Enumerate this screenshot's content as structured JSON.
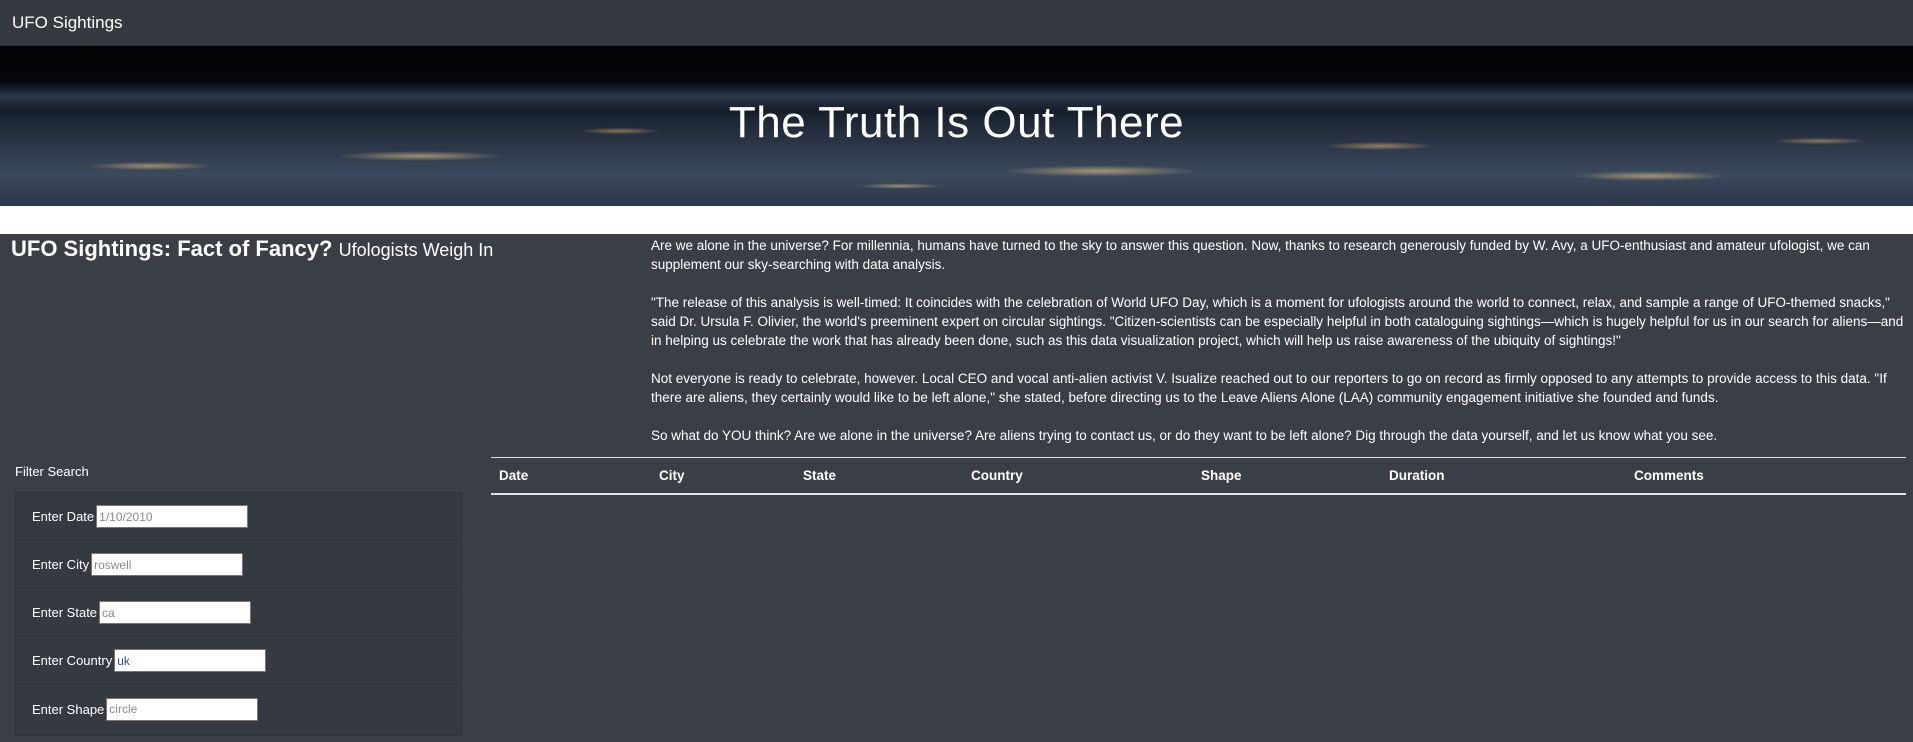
{
  "navbar": {
    "brand": "UFO Sightings"
  },
  "hero": {
    "title": "The Truth Is Out There"
  },
  "intro": {
    "title_strong": "UFO Sightings: Fact of Fancy?",
    "title_light": "Ufologists Weigh In"
  },
  "article": {
    "paragraphs": [
      "Are we alone in the universe? For millennia, humans have turned to the sky to answer this question. Now, thanks to research generously funded by W. Avy, a UFO-enthusiast and amateur ufologist, we can supplement our sky-searching with data analysis.",
      "\"The release of this analysis is well-timed: It coincides with the celebration of World UFO Day, which is a moment for ufologists around the world to connect, relax, and sample a range of UFO-themed snacks,\" said Dr. Ursula F. Olivier, the world's preeminent expert on circular sightings. \"Citizen-scientists can be especially helpful in both cataloguing sightings—which is hugely helpful for us in our search for aliens—and in helping us celebrate the work that has already been done, such as this data visualization project, which will help us raise awareness of the ubiquity of sightings!\"",
      "Not everyone is ready to celebrate, however. Local CEO and vocal anti-alien activist V. Isualize reached out to our reporters to go on record as firmly opposed to any attempts to provide access to this data. \"If there are aliens, they certainly would like to be left alone,\" she stated, before directing us to the Leave Aliens Alone (LAA) community engagement initiative she founded and funds.",
      "So what do YOU think? Are we alone in the universe? Are aliens trying to contact us, or do they want to be left alone? Dig through the data yourself, and let us know what you see."
    ]
  },
  "filters": {
    "heading": "Filter Search",
    "date": {
      "label": "Enter Date",
      "placeholder": "1/10/2010",
      "value": ""
    },
    "city": {
      "label": "Enter City",
      "placeholder": "roswell",
      "value": ""
    },
    "state": {
      "label": "Enter State",
      "placeholder": "ca",
      "value": ""
    },
    "country": {
      "label": "Enter Country",
      "placeholder": "",
      "value": "uk"
    },
    "shape": {
      "label": "Enter Shape",
      "placeholder": "circle",
      "value": ""
    }
  },
  "table": {
    "columns": [
      "Date",
      "City",
      "State",
      "Country",
      "Shape",
      "Duration",
      "Comments"
    ],
    "rows": []
  }
}
